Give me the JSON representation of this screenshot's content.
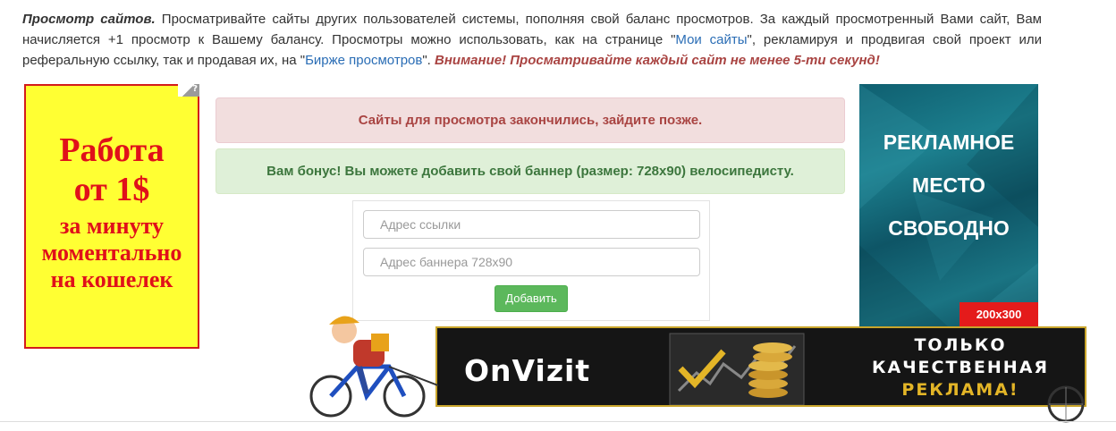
{
  "intro": {
    "title": "Просмотр сайтов.",
    "text1": " Просматривайте сайты других пользователей системы, пополняя свой баланс просмотров. За каждый просмотренный Вами сайт, Вам начисляется +1 просмотр к Вашему балансу. Просмотры можно использовать, как на странице \"",
    "link1": "Мои сайты",
    "text2": "\", рекламируя и продвигая свой проект или реферальную ссылку, так и продавая их, на \"",
    "link2": "Бирже просмотров",
    "text3": "\". ",
    "warning": "Внимание! Просматривайте каждый сайт не менее 5-ти секунд!"
  },
  "left_ad": {
    "line1": "Работа",
    "line2": "от 1$",
    "line3": "за минуту",
    "line4": "моментально",
    "line5": "на кошелек",
    "corner": "?"
  },
  "alerts": {
    "danger": "Сайты для просмотра закончились, зайдите позже.",
    "success": "Вам бонус! Вы можете добавить свой баннер (размер: 728x90) велосипедисту."
  },
  "form": {
    "link_placeholder": "Адрес ссылки",
    "banner_placeholder": "Адрес баннера 728x90",
    "submit_label": "Добавить"
  },
  "right_ad": {
    "line1": "РЕКЛАМНОЕ",
    "line2": "МЕСТО",
    "line3": "СВОБОДНО",
    "size": "200x300"
  },
  "banner": {
    "brand": "OnVizit",
    "tag1": "ТОЛЬКО",
    "tag2": "КАЧЕСТВЕННАЯ",
    "tag3": "РЕКЛАМА!"
  },
  "colors": {
    "danger_bg": "#f2dede",
    "success_bg": "#dff0d8",
    "button": "#5cb85c",
    "link": "#2a6db5"
  }
}
